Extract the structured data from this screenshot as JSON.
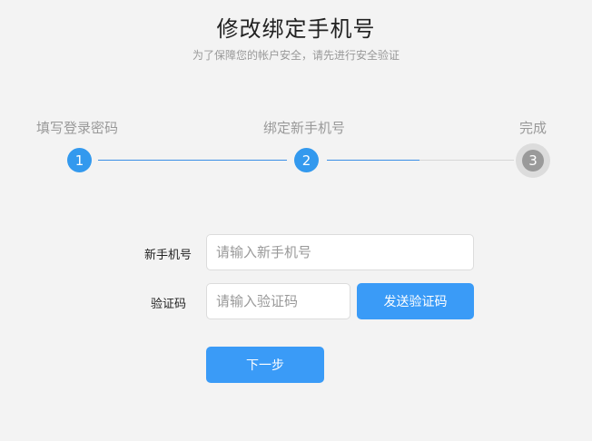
{
  "header": {
    "title": "修改绑定手机号",
    "subtitle": "为了保障您的帐户安全，请先进行安全验证"
  },
  "steps": [
    {
      "label": "填写登录密码",
      "number": "1",
      "status": "done"
    },
    {
      "label": "绑定新手机号",
      "number": "2",
      "status": "current"
    },
    {
      "label": "完成",
      "number": "3",
      "status": "pending"
    }
  ],
  "form": {
    "phone_label": "新手机号",
    "phone_placeholder": "请输入新手机号",
    "phone_value": "",
    "code_label": "验证码",
    "code_placeholder": "请输入验证码",
    "code_value": "",
    "send_code_label": "发送验证码",
    "next_label": "下一步"
  },
  "colors": {
    "accent": "#3a9bf7",
    "step_done": "#3399ee",
    "step_pending": "#9a9a9a",
    "background": "#f3f3f3"
  }
}
